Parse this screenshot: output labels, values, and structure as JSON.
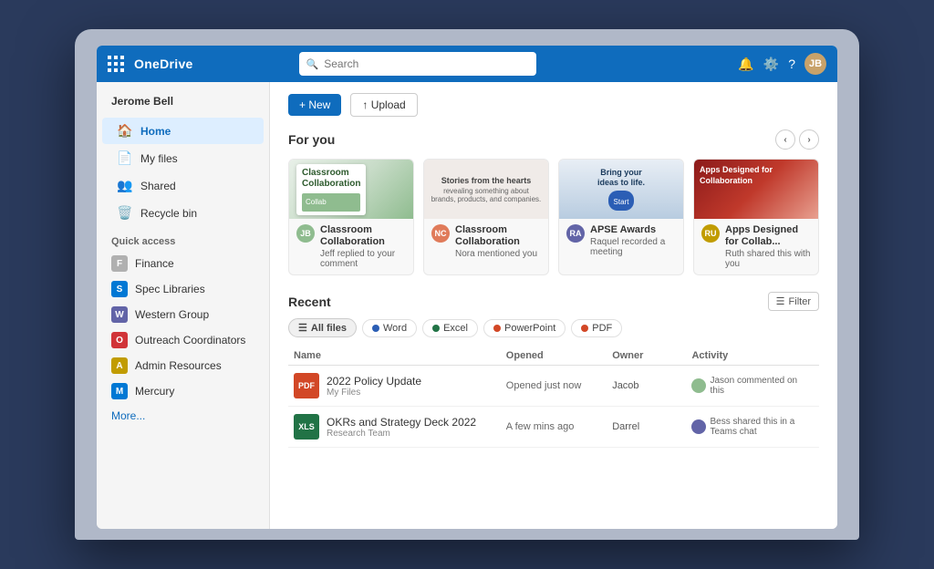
{
  "app": {
    "brand": "OneDrive",
    "search_placeholder": "Search"
  },
  "topbar": {
    "avatar_initials": "JB"
  },
  "sidebar": {
    "username": "Jerome Bell",
    "nav_items": [
      {
        "id": "home",
        "label": "Home",
        "icon": "🏠",
        "active": true
      },
      {
        "id": "myfiles",
        "label": "My files",
        "icon": "📄",
        "active": false
      },
      {
        "id": "shared",
        "label": "Shared",
        "icon": "👥",
        "active": false
      },
      {
        "id": "recycle",
        "label": "Recycle bin",
        "icon": "🗑️",
        "active": false
      }
    ],
    "quick_access_label": "Quick access",
    "quick_items": [
      {
        "id": "finance",
        "label": "Finance",
        "color": "#b0b0b0"
      },
      {
        "id": "spec-lib",
        "label": "Spec Libraries",
        "color": "#0078d4"
      },
      {
        "id": "western",
        "label": "Western Group",
        "color": "#6264a7"
      },
      {
        "id": "outreach",
        "label": "Outreach Coordinators",
        "color": "#d13438"
      },
      {
        "id": "admin",
        "label": "Admin Resources",
        "color": "#c19c00"
      },
      {
        "id": "mercury",
        "label": "Mercury",
        "color": "#0078d4"
      }
    ],
    "more_label": "More..."
  },
  "toolbar": {
    "new_label": "+ New",
    "upload_label": "↑ Upload"
  },
  "for_you": {
    "section_label": "For you",
    "cards": [
      {
        "id": "card1",
        "title": "Classroom Collaboration",
        "sub": "Jeff replied to your comment",
        "thumb_type": "classroom",
        "thumb_text": "Classroom\nCollaboration",
        "avatar_color": "#8fbc8f",
        "avatar_initials": "JB"
      },
      {
        "id": "card2",
        "title": "Classroom Collaboration",
        "sub": "Nora mentioned you",
        "thumb_type": "collab",
        "thumb_text": "Stories from the hearts...",
        "avatar_color": "#e07b5a",
        "avatar_initials": "NC"
      },
      {
        "id": "card3",
        "title": "APSE Awards",
        "sub": "Raquel recorded a meeting",
        "thumb_type": "bring",
        "thumb_text": "Bring your ideas to life.",
        "avatar_color": "#6264a7",
        "avatar_initials": "RA"
      },
      {
        "id": "card4",
        "title": "Apps Designed for Collab...",
        "sub": "Ruth shared this with you",
        "thumb_type": "apps",
        "thumb_text": "Apps Designed for\nCollaboration",
        "avatar_color": "#c19c00",
        "avatar_initials": "RU"
      }
    ]
  },
  "recent": {
    "section_label": "Recent",
    "filter_label": "Filter",
    "file_tabs": [
      {
        "id": "all",
        "label": "All files",
        "color": null,
        "active": true
      },
      {
        "id": "word",
        "label": "Word",
        "color": "#2b5eb5"
      },
      {
        "id": "excel",
        "label": "Excel",
        "color": "#217346"
      },
      {
        "id": "ppt",
        "label": "PowerPoint",
        "color": "#d24726"
      },
      {
        "id": "pdf",
        "label": "PDF",
        "color": "#d24726"
      }
    ],
    "table_headers": {
      "name": "Name",
      "opened": "Opened",
      "owner": "Owner",
      "activity": "Activity"
    },
    "files": [
      {
        "id": "file1",
        "icon_color": "#d24726",
        "icon_letters": "PDF",
        "name": "2022 Policy Update",
        "location": "My Files",
        "opened": "Opened just now",
        "owner": "Jacob",
        "activity": "Jason commented on this",
        "activity_avatar_color": "#8fbc8f"
      },
      {
        "id": "file2",
        "icon_color": "#217346",
        "icon_letters": "XLS",
        "name": "OKRs and Strategy Deck 2022",
        "location": "Research Team",
        "opened": "A few mins ago",
        "owner": "Darrel",
        "activity": "Bess shared this in a Teams chat",
        "activity_avatar_color": "#6264a7"
      }
    ]
  }
}
